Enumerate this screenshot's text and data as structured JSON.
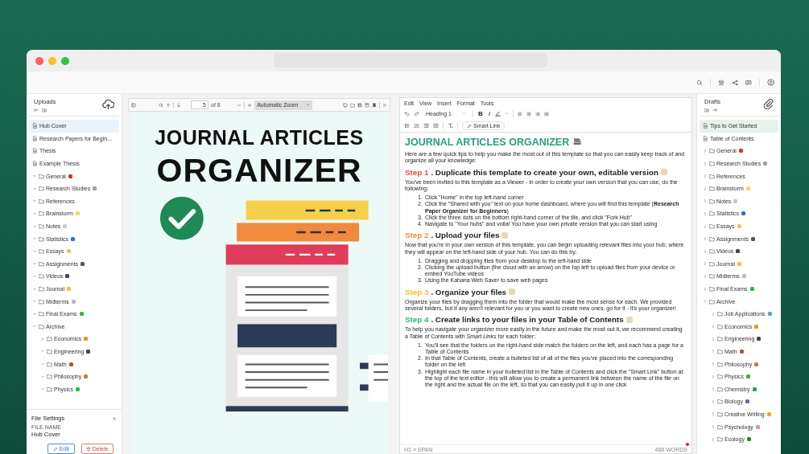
{
  "uploads": {
    "title": "Uploads",
    "items": [
      {
        "kind": "file",
        "label": "Hub Cover",
        "selected": true
      },
      {
        "kind": "file",
        "label": "Research Papers for Begin...",
        "selected": false
      },
      {
        "kind": "file",
        "label": "Thesis",
        "selected": false
      },
      {
        "kind": "file",
        "label": "Example Thesis",
        "selected": false
      },
      {
        "kind": "folder",
        "label": "General",
        "color": "#d8342b",
        "expanded": true,
        "selected": false
      },
      {
        "kind": "folder",
        "label": "Research Studies",
        "color": "#9aa4ae",
        "expanded": true,
        "selected": false
      },
      {
        "kind": "folder",
        "label": "References",
        "expanded": true,
        "selected": false
      },
      {
        "kind": "folder",
        "label": "Brainstorm",
        "color": "#f3d66a",
        "expanded": true,
        "selected": false
      },
      {
        "kind": "folder",
        "label": "Notes",
        "color": "#c8c8c8",
        "expanded": true,
        "selected": false
      },
      {
        "kind": "folder",
        "label": "Statistics",
        "color": "#3b6fb6",
        "expanded": true,
        "selected": false
      },
      {
        "kind": "folder",
        "label": "Essays",
        "color": "#e6c66a",
        "expanded": true,
        "selected": false
      },
      {
        "kind": "folder",
        "label": "Assignments",
        "color": "#555555",
        "expanded": true,
        "selected": false
      },
      {
        "kind": "folder",
        "label": "Videos",
        "color": "#444444",
        "expanded": true,
        "selected": false
      },
      {
        "kind": "folder",
        "label": "Journal",
        "color": "#f0c040",
        "expanded": true,
        "selected": false
      },
      {
        "kind": "folder",
        "label": "Midterms",
        "color": "#bbbbbb",
        "expanded": true,
        "selected": false
      },
      {
        "kind": "folder",
        "label": "Final Exams",
        "color": "#3cb043",
        "expanded": true,
        "selected": false
      },
      {
        "kind": "folder",
        "label": "Archive",
        "expanded": true,
        "selected": false,
        "children": [
          {
            "kind": "folder",
            "label": "Economics",
            "color": "#d4a017",
            "expanded": false,
            "selected": false
          },
          {
            "kind": "folder",
            "label": "Engineering",
            "color": "#444444",
            "expanded": true,
            "selected": false
          },
          {
            "kind": "folder",
            "label": "Math",
            "color": "#b5533c",
            "expanded": true,
            "selected": false
          },
          {
            "kind": "folder",
            "label": "Philosophy",
            "color": "#c08040",
            "expanded": true,
            "selected": false
          },
          {
            "kind": "folder",
            "label": "Physics",
            "color": "#3cb043",
            "expanded": true,
            "selected": false
          }
        ]
      }
    ]
  },
  "file_settings": {
    "title": "File Settings",
    "field_label": "FILE NAME",
    "file_name": "Hub Cover",
    "buttons": [
      {
        "kind": "edit",
        "label": "Edit"
      },
      {
        "kind": "delete",
        "label": "Delete"
      }
    ]
  },
  "pdf_viewer": {
    "page_input": "5",
    "page_count": "of 8",
    "zoom": "Automatic Zoom",
    "page_title": [
      "JOURNAL ARTICLES",
      "ORGANIZER"
    ]
  },
  "editor": {
    "menu": [
      "Edit",
      "View",
      "Insert",
      "Format",
      "Tools"
    ],
    "block_style": "Heading 1",
    "format_buttons": [
      "B",
      "I"
    ],
    "smart_link": "Smart Link",
    "title": "JOURNAL ARTICLES ORGANIZER",
    "intro": "Here are a few quick tips to help you make the most out of this template so that you can easily keep track of and organize all your knowledge:",
    "steps": [
      {
        "label": "Step 1",
        "heading": ". Duplicate this template to create your own, editable version",
        "color": "#e5533d",
        "paragraph": "You've been invited to this template as a Viewer - in order to create your own version that you can use, do the following:",
        "list": [
          {
            "number": "1.",
            "text": "Click \"Home\" in the top left-hand corner"
          },
          {
            "number": "2.",
            "text": "Click the \"Shared with you\" text on your home dashboard, where you will find this template (**Research Paper Organizer for Beginners**)"
          },
          {
            "number": "3.",
            "text": "Click the three dots on the bottom right-hand corner of the tile, and click \"Fork Hub\""
          },
          {
            "number": "4.",
            "text": "Navigate to \"Your hubs\" and voila! You have your own private version that you can start using"
          }
        ]
      },
      {
        "label": "Step 2",
        "heading": ". Upload your files",
        "color": "#e8913a",
        "paragraph": "Now that you're in your own version of this template, you can begin uploading relevant files into your hub, where they will appear on the left-hand side of your hub. You can do this by:",
        "list": [
          {
            "number": "1.",
            "text": "Dragging and dropping files from your desktop to the left-hand side"
          },
          {
            "number": "2.",
            "text": "Clicking the upload button (the cloud with an arrow) on the top left to upload files from your device or embed YouTube videos"
          },
          {
            "number": "3.",
            "text": "Using the Kahana Web Saver to save web pages"
          }
        ]
      },
      {
        "label": "Step 3",
        "heading": ". Organize your files",
        "color": "#f0c330",
        "paragraph": "Organize your files by dragging them into the folder that would make the most sense for each. We provided several folders, but if any aren't relevant for you or you want to create new ones, go for it - it's your organizer!"
      },
      {
        "label": "Step 4",
        "heading": ". Create links to your files in your Table of Contents",
        "color": "#2fb56a",
        "paragraph": "To help you navigate your organizer more easily in the future and make the most out it, we recommend creating a Table of Contents with *Smart Links* for each folder:",
        "list": [
          {
            "number": "1.",
            "text": "You'll see that the folders on the right-hand side match the folders on the left, and each has a page for a Table of Contents"
          },
          {
            "number": "2.",
            "text": "In that Table of Contents, create a bulleted list of all of the files you've placed into the corresponding folder on the left"
          },
          {
            "number": "3.",
            "text": "Highlight each file name in your bulleted list in the Table of Contents and click the \"Smart Link\" button at the top of the text editor - this will allow you to create a permanent link between the name of the file on the right and the actual file on the left, so that you can easily pull it up in one click"
          }
        ]
      }
    ],
    "element_path": "H1 » SPAN",
    "word_count": "468 WORDS"
  },
  "drafts": {
    "title": "Drafts",
    "items": [
      {
        "kind": "file",
        "label": "Tips to Get Started",
        "selected": true
      },
      {
        "kind": "file",
        "label": "Table of Contents",
        "selected": false
      },
      {
        "kind": "folder",
        "label": "General",
        "color": "#d8342b",
        "expanded": false,
        "selected": false
      },
      {
        "kind": "folder",
        "label": "Research Studies",
        "color": "#9aa4ae",
        "expanded": false,
        "selected": false
      },
      {
        "kind": "folder",
        "label": "References",
        "expanded": false,
        "selected": false
      },
      {
        "kind": "folder",
        "label": "Brainstorm",
        "color": "#f3d66a",
        "expanded": false,
        "selected": false
      },
      {
        "kind": "folder",
        "label": "Notes",
        "color": "#c8c8c8",
        "expanded": false,
        "selected": false
      },
      {
        "kind": "folder",
        "label": "Statistics",
        "color": "#3b6fb6",
        "expanded": false,
        "selected": false
      },
      {
        "kind": "folder",
        "label": "Essays",
        "color": "#e6c66a",
        "expanded": false,
        "selected": false
      },
      {
        "kind": "folder",
        "label": "Assignments",
        "color": "#555555",
        "expanded": false,
        "selected": false
      },
      {
        "kind": "folder",
        "label": "Videos",
        "color": "#444444",
        "expanded": false,
        "selected": false
      },
      {
        "kind": "folder",
        "label": "Journal",
        "color": "#f0c040",
        "expanded": false,
        "selected": false
      },
      {
        "kind": "folder",
        "label": "Midterms",
        "color": "#bbbbbb",
        "expanded": false,
        "selected": false
      },
      {
        "kind": "folder",
        "label": "Final Exams",
        "color": "#3cb043",
        "expanded": false,
        "selected": false
      },
      {
        "kind": "folder",
        "label": "Archive",
        "expanded": true,
        "selected": false,
        "children": [
          {
            "kind": "folder",
            "label": "Job Applications",
            "color": "#5ba3d0",
            "expanded": false,
            "selected": false
          },
          {
            "kind": "folder",
            "label": "Economics",
            "color": "#d4a017",
            "expanded": false,
            "selected": false
          },
          {
            "kind": "folder",
            "label": "Engineering",
            "color": "#444444",
            "expanded": false,
            "selected": false
          },
          {
            "kind": "folder",
            "label": "Math",
            "color": "#b5533c",
            "expanded": false,
            "selected": false
          },
          {
            "kind": "folder",
            "label": "Philosophy",
            "color": "#c08040",
            "expanded": false,
            "selected": false
          },
          {
            "kind": "folder",
            "label": "Physics",
            "color": "#3cb043",
            "expanded": false,
            "selected": false
          },
          {
            "kind": "folder",
            "label": "Chemistry",
            "color": "#2e9e48",
            "expanded": false,
            "selected": false
          },
          {
            "kind": "folder",
            "label": "Biology",
            "color": "#7a5cd6",
            "expanded": false,
            "selected": false
          },
          {
            "kind": "folder",
            "label": "Creative Writing",
            "color": "#e0b030",
            "expanded": false,
            "selected": false
          },
          {
            "kind": "folder",
            "label": "Psychology",
            "color": "#e88ca0",
            "expanded": false,
            "selected": false
          },
          {
            "kind": "folder",
            "label": "Ecology",
            "color": "#2f7d32",
            "expanded": false,
            "selected": false
          }
        ]
      }
    ]
  }
}
